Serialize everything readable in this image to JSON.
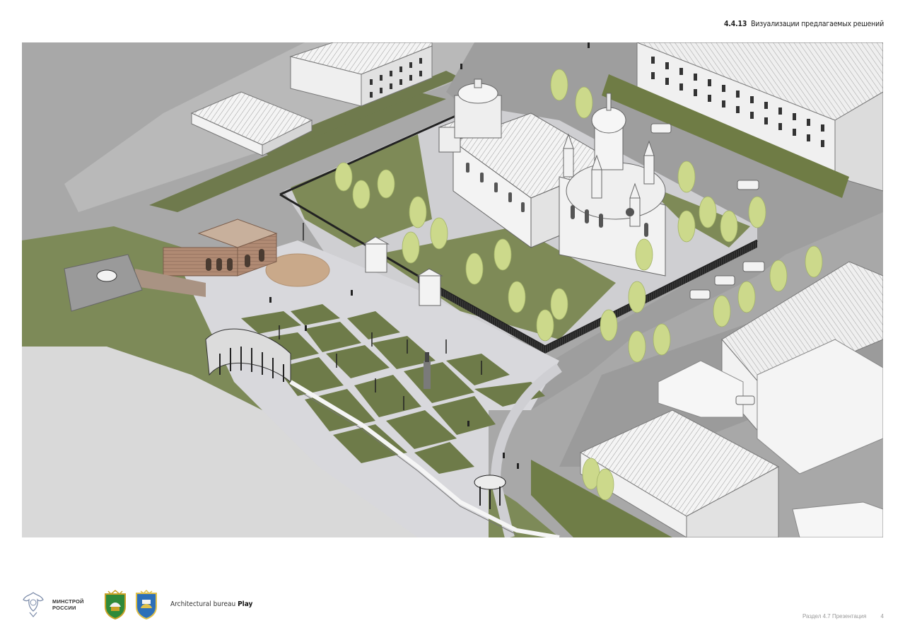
{
  "header": {
    "section_number": "4.4.13",
    "section_title": "Визуализации предлагаемых решений"
  },
  "footer": {
    "ministry_line1": "МИНСТРОЙ",
    "ministry_line2": "РОССИИ",
    "bureau_prefix": "Architectural bureau",
    "bureau_name": "Play",
    "section_label": "Раздел 4.7 Презентация",
    "page_number": "4"
  },
  "icons": {
    "ministry_emblem": "double-headed-eagle-emblem",
    "oblast_emblem": "oblast-coat-of-arms",
    "city_emblem": "city-coat-of-arms"
  },
  "colors": {
    "grass": "#7f8a5c",
    "paving": "#d6d6da",
    "tree": "#c9d78a",
    "building": "#f1f1f1",
    "road": "#a9a9a9",
    "fence": "#2a2a2a"
  }
}
